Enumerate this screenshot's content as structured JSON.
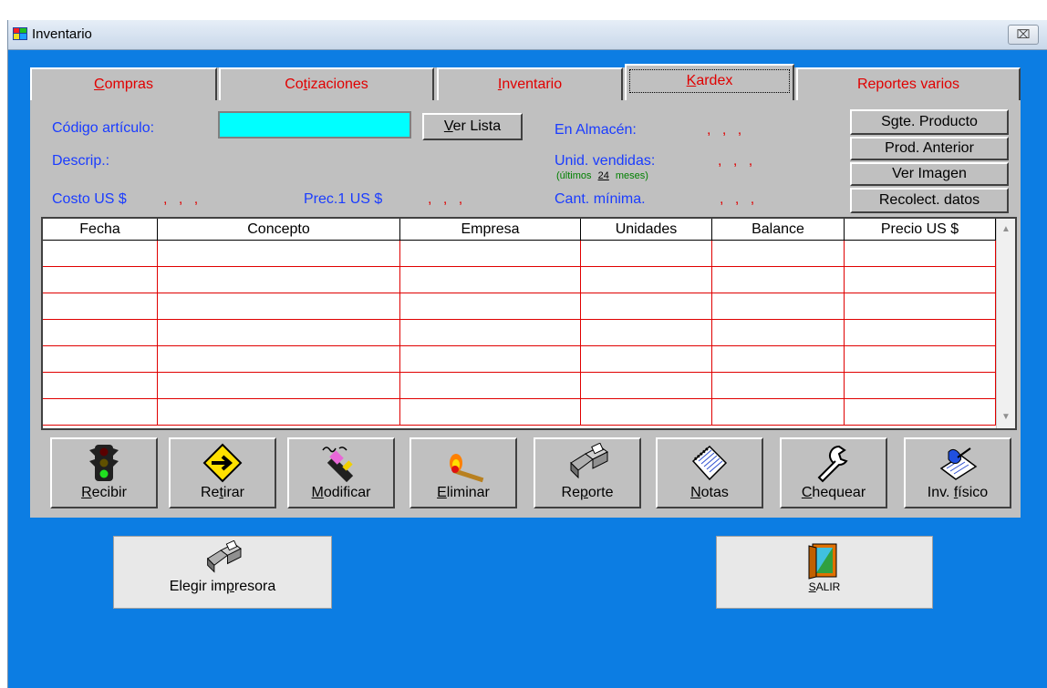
{
  "window": {
    "title": "Inventario",
    "close_glyph": "⌧"
  },
  "tabs": [
    {
      "pre": "",
      "ul": "C",
      "post": "ompras"
    },
    {
      "pre": "Co",
      "ul": "t",
      "post": "izaciones"
    },
    {
      "pre": "",
      "ul": "I",
      "post": "nventario"
    },
    {
      "pre": "",
      "ul": "K",
      "post": "ardex"
    },
    {
      "pre": "",
      "ul": "",
      "post": "Reportes varios"
    }
  ],
  "form": {
    "codigo_label": "Código artículo:",
    "codigo_value": "",
    "ver_lista": {
      "ul": "V",
      "post": "er Lista"
    },
    "descrip_label": "Descrip.:",
    "costo_label": "Costo US $",
    "costo_value": ", , ,",
    "prec_label": "Prec.1 US $",
    "prec_value": ", , ,",
    "almacen_label": "En Almacén:",
    "almacen_value": ", , ,",
    "vendidas_label": "Unid. vendidas:",
    "vendidas_value": ", , ,",
    "ultimos_pre": "(últimos",
    "ultimos_num": "24",
    "ultimos_post": "meses)",
    "minima_label": "Cant. mínima.",
    "minima_value": ", , ,"
  },
  "side_buttons": {
    "sgte": "Sgte. Producto",
    "anterior": "Prod. Anterior",
    "imagen": "Ver Imagen",
    "recolect": "Recolect. datos"
  },
  "table": {
    "headers": [
      "Fecha",
      "Concepto",
      "Empresa",
      "Unidades",
      "Balance",
      "Precio US $"
    ],
    "row_count": 7
  },
  "toolbar": [
    {
      "pre": "",
      "ul": "R",
      "post": "ecibir",
      "icon": "traffic-light-icon"
    },
    {
      "pre": "Re",
      "ul": "t",
      "post": "irar",
      "icon": "arrow-sign-icon"
    },
    {
      "pre": "",
      "ul": "M",
      "post": "odificar",
      "icon": "eraser-pencil-icon"
    },
    {
      "pre": "",
      "ul": "E",
      "post": "liminar",
      "icon": "burning-match-icon"
    },
    {
      "pre": "Re",
      "ul": "p",
      "post": "orte",
      "icon": "printer-icon"
    },
    {
      "pre": "",
      "ul": "N",
      "post": "otas",
      "icon": "notepad-icon"
    },
    {
      "pre": "",
      "ul": "C",
      "post": "hequear",
      "icon": "wrench-icon"
    },
    {
      "pre": "Inv. ",
      "ul": "f",
      "post": "ísico",
      "icon": "writing-hand-icon"
    }
  ],
  "bottom": {
    "printer": {
      "pre": "Elegir im",
      "ul": "p",
      "post": "resora"
    },
    "exit": {
      "pre": "",
      "ul": "S",
      "post": "ALIR"
    }
  },
  "colors": {
    "background": "#0c7de3",
    "panel": "#c0c0c0",
    "label_blue": "#1a3cff",
    "red": "#e00000",
    "input_cyan": "#00ffff",
    "green": "#008000"
  }
}
